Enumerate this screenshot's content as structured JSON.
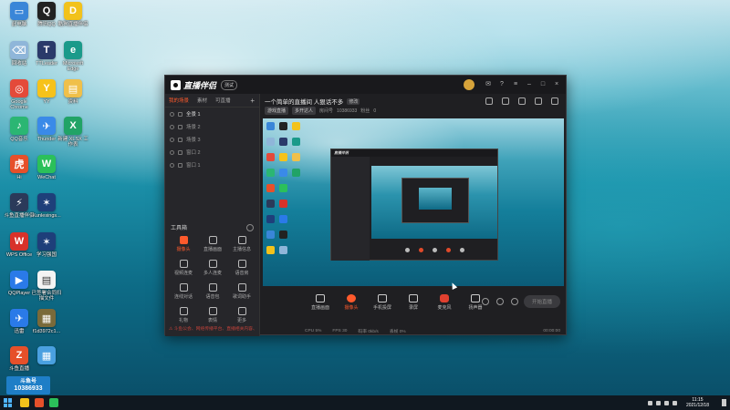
{
  "desktop": {
    "icons": [
      {
        "label": "此电脑",
        "color": "#3a86d8",
        "glyph": "▭"
      },
      {
        "label": "腾讯QQ",
        "color": "#222222",
        "glyph": "Q"
      },
      {
        "label": "酷狗直播伴侣",
        "color": "#f2c21b",
        "glyph": "D"
      },
      {
        "label": "回收站",
        "color": "#8fb6d9",
        "glyph": "⌫"
      },
      {
        "label": "TTLeader",
        "color": "#2a3a6a",
        "glyph": "T"
      },
      {
        "label": "Microsoft Edge",
        "color": "#1a9a8a",
        "glyph": "e"
      },
      {
        "label": "Google Chrome",
        "color": "#e44a3a",
        "glyph": "◎"
      },
      {
        "label": "YY",
        "color": "#f6c21a",
        "glyph": "Y"
      },
      {
        "label": "资料",
        "color": "#f0c04a",
        "glyph": "▤"
      },
      {
        "label": "QQ音乐",
        "color": "#2bb673",
        "glyph": "♪"
      },
      {
        "label": "Thunder",
        "color": "#3a8ae8",
        "glyph": "✈"
      },
      {
        "label": "新建 XLSX 工作表",
        "color": "#21a366",
        "glyph": "X"
      },
      {
        "label": "Hi",
        "color": "#e6502a",
        "glyph": "虎"
      },
      {
        "label": "WeChat",
        "color": "#2bc05a",
        "glyph": "W"
      },
      {
        "label": "斗鱼直播伴侣",
        "color": "#2b3a5a",
        "glyph": "⚡"
      },
      {
        "label": "斗鱼直播",
        "color": "#f2a21b",
        "glyph": "D"
      },
      {
        "label": "Xunlesings...",
        "color": "#1e3f7a",
        "glyph": "✶"
      },
      {
        "label": "WPS Office",
        "color": "#d8322a",
        "glyph": "W"
      },
      {
        "label": "学习强国",
        "color": "#1e3f7a",
        "glyph": "✶"
      },
      {
        "label": "QQPlayer",
        "color": "#2a7ae8",
        "glyph": "▶"
      },
      {
        "label": "已签署合同扫描文件",
        "color": "#f4f4f4",
        "glyph": "▤"
      },
      {
        "label": "迅雷",
        "color": "#2a7ae8",
        "glyph": "✈"
      },
      {
        "label": "f1d3972c1...",
        "color": "#7a6a3a",
        "glyph": "▦"
      },
      {
        "label": "斗鱼直播",
        "color": "#e6502a",
        "glyph": "Z"
      },
      {
        "label": "",
        "color": "#4aa0e0",
        "glyph": "▦"
      }
    ]
  },
  "app": {
    "name": "直播伴侣",
    "version_badge": "测试",
    "left_tabs": [
      "我的场景",
      "素材",
      "可直播"
    ],
    "scenes": [
      "全景 1",
      "场景 2",
      "场景 3",
      "窗口 2",
      "窗口 1"
    ],
    "toolbox_title": "工具箱",
    "tools": [
      {
        "label": "摄像头",
        "active": true
      },
      {
        "label": "直播画面",
        "active": false
      },
      {
        "label": "主播信息",
        "active": false
      },
      {
        "label": "视频连麦",
        "active": false
      },
      {
        "label": "多人连麦",
        "active": false
      },
      {
        "label": "语音房",
        "active": false
      },
      {
        "label": "连线对话",
        "active": false
      },
      {
        "label": "语音包",
        "active": false
      },
      {
        "label": "歌词助手",
        "active": false
      },
      {
        "label": "礼物",
        "active": false
      },
      {
        "label": "表情",
        "active": false
      },
      {
        "label": "更多",
        "active": false
      }
    ],
    "notice": "⚠ 斗鱼公会、网络传播平台、直播相关内容、登上一级等",
    "stream_title": "一个简单的直播间 人狠话不多",
    "edit_tag": "修改",
    "meta_chips": [
      "游戏直播",
      "多开达人"
    ],
    "room_label": "房间号",
    "room_id": "10386933",
    "fans_label": "粉丝",
    "fans_count": "0",
    "controls": [
      {
        "label": "直播画面",
        "active": false,
        "mic": false
      },
      {
        "label": "摄像头",
        "active": true,
        "mic": false
      },
      {
        "label": "手机投屏",
        "active": false,
        "mic": false
      },
      {
        "label": "录屏",
        "active": false,
        "mic": false
      },
      {
        "label": "麦克风",
        "active": false,
        "mic": true
      },
      {
        "label": "扬声器",
        "active": false,
        "mic": false
      }
    ],
    "start_button": "开始直播",
    "status": {
      "cpu": "CPU 5%",
      "fps": "FPS 30",
      "bitrate": "码率 0kb/s",
      "dropped": "丢帧 0%",
      "duration": "00:00:00"
    },
    "preview_inner_title": "直播伴侣"
  },
  "overlay": {
    "title": "斗鱼号",
    "number": "10386933"
  },
  "taskbar": {
    "time": "11:15",
    "date": "2021/12/18",
    "apps": [
      "#f2c21b",
      "#e6502a",
      "#2bc05a"
    ]
  }
}
